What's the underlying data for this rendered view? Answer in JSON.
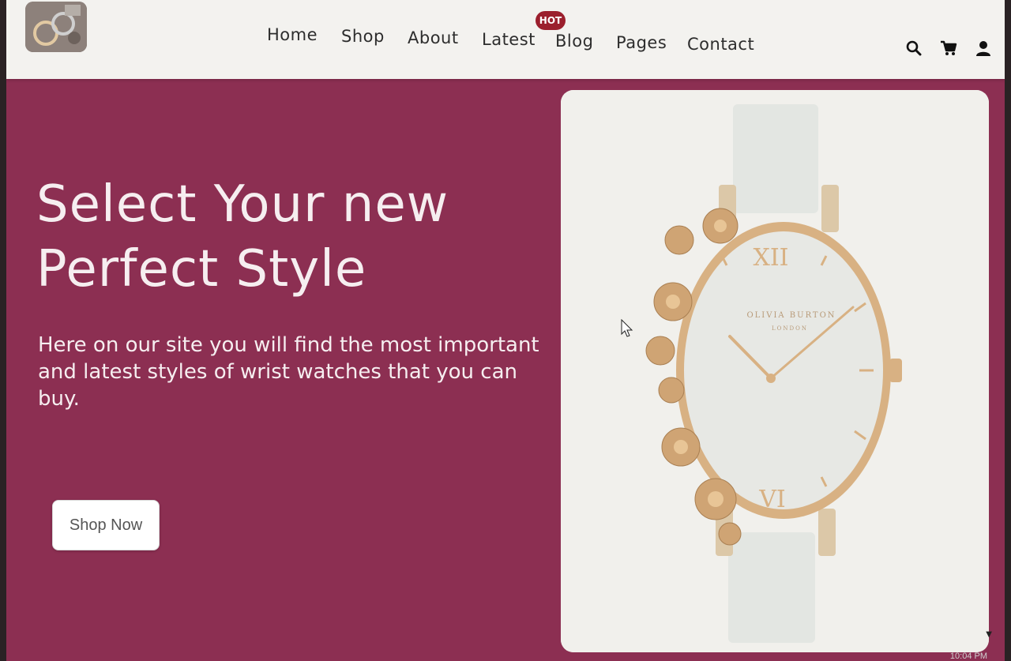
{
  "nav": {
    "items": [
      {
        "label": "Home"
      },
      {
        "label": "Shop"
      },
      {
        "label": "About"
      },
      {
        "label": "Latest"
      },
      {
        "label": "Blog"
      },
      {
        "label": "Pages"
      },
      {
        "label": "Contact"
      }
    ],
    "hot_badge": "HOT"
  },
  "header_icons": [
    "search-icon",
    "cart-icon",
    "user-icon"
  ],
  "hero": {
    "title_line1": "Select Your new",
    "title_line2": "Perfect Style",
    "subtitle": "Here on our site you will find the most important and latest styles of wrist watches that you can buy.",
    "cta_label": "Shop Now",
    "watch_brand": "OLIVIA BURTON",
    "watch_city": "LONDON",
    "numeral_top": "XII",
    "numeral_bottom": "VI"
  },
  "system": {
    "time": "10:04 PM"
  },
  "colors": {
    "hero_background": "#8c2f52",
    "header_background": "#f3f2ef",
    "hot_badge": "#9b1f2d",
    "watch_gold": "#d8b183"
  }
}
